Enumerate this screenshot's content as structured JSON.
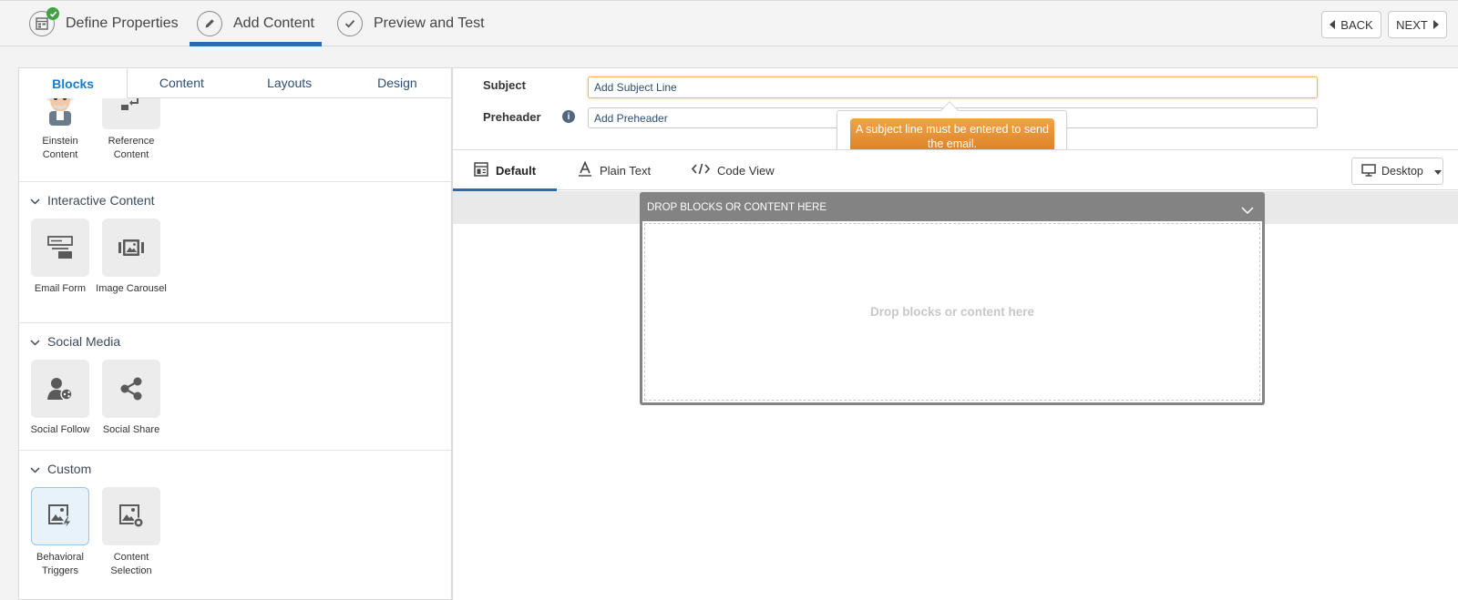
{
  "wizard": {
    "steps": [
      {
        "label": "Define Properties",
        "icon": "grid-check-icon",
        "completed": true
      },
      {
        "label": "Add Content",
        "icon": "pencil-icon",
        "active": true
      },
      {
        "label": "Preview and Test",
        "icon": "checkmark-icon"
      }
    ],
    "back_label": "BACK",
    "next_label": "NEXT"
  },
  "left_panel": {
    "tabs": [
      {
        "label": "Blocks",
        "active": true
      },
      {
        "label": "Content"
      },
      {
        "label": "Layouts"
      },
      {
        "label": "Design"
      }
    ],
    "sections": [
      {
        "title": "",
        "tiles": [
          {
            "label": "Einstein Content",
            "icon": "einstein-icon"
          },
          {
            "label": "Reference Content",
            "icon": "reference-icon"
          }
        ]
      },
      {
        "title": "Interactive Content",
        "tiles": [
          {
            "label": "Email Form",
            "icon": "form-icon"
          },
          {
            "label": "Image Carousel",
            "icon": "carousel-icon"
          }
        ]
      },
      {
        "title": "Social Media",
        "tiles": [
          {
            "label": "Social Follow",
            "icon": "social-follow-icon"
          },
          {
            "label": "Social Share",
            "icon": "share-icon"
          }
        ]
      },
      {
        "title": "Custom",
        "tiles": [
          {
            "label": "Behavioral Triggers",
            "icon": "behavioral-triggers-icon"
          },
          {
            "label": "Content Selection",
            "icon": "content-selection-icon"
          }
        ]
      }
    ]
  },
  "header_fields": {
    "subject_label": "Subject",
    "subject_placeholder": "Add Subject Line",
    "preheader_label": "Preheader",
    "preheader_placeholder": "Add Preheader",
    "tooltip": "A subject line must be entered to send the email."
  },
  "view_tabs": [
    {
      "label": "Default",
      "icon": "layout-icon",
      "active": true
    },
    {
      "label": "Plain Text",
      "icon": "text-icon"
    },
    {
      "label": "Code View",
      "icon": "code-icon"
    }
  ],
  "device_select": "Desktop",
  "dropzone": {
    "header": "DROP BLOCKS OR CONTENT HERE",
    "placeholder": "Drop blocks or content here"
  },
  "colors": {
    "accent": "#2a6bb0",
    "tab_active": "#1a7cc7",
    "warning": "#e58a2c",
    "success": "#44a046"
  }
}
